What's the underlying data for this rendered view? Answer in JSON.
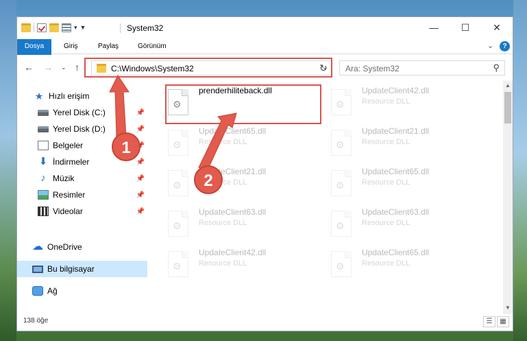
{
  "window": {
    "title": "System32",
    "minimize_icon": "—",
    "maximize_icon": "☐",
    "close_icon": "✕"
  },
  "ribbon": {
    "tabs": [
      "Dosya",
      "Giriş",
      "Paylaş",
      "Görünüm"
    ],
    "file_color": "#1979ca",
    "help_label": "?"
  },
  "address": {
    "path": "C:\\Windows\\System32",
    "search_placeholder": "Ara: System32"
  },
  "sidebar": {
    "items": [
      {
        "label": "Hızlı erişim",
        "icon": "star-icon"
      },
      {
        "label": "Yerel Disk (C:)",
        "icon": "disk-icon",
        "pinned": true
      },
      {
        "label": "Yerel Disk (D:)",
        "icon": "disk-icon",
        "pinned": true
      },
      {
        "label": "Belgeler",
        "icon": "document-icon",
        "pinned": true
      },
      {
        "label": "İndirmeler",
        "icon": "download-icon",
        "pinned": true
      },
      {
        "label": "Müzik",
        "icon": "music-icon",
        "pinned": true
      },
      {
        "label": "Resimler",
        "icon": "pictures-icon",
        "pinned": true
      },
      {
        "label": "Videolar",
        "icon": "videos-icon",
        "pinned": true
      },
      {
        "label": "OneDrive",
        "icon": "onedrive-icon"
      },
      {
        "label": "Bu bilgisayar",
        "icon": "computer-icon",
        "selected": true
      },
      {
        "label": "Ağ",
        "icon": "network-icon"
      }
    ]
  },
  "files": {
    "left_column": [
      {
        "name": "prenderhiliteback.dll",
        "type": ""
      },
      {
        "name": "UpdateClient65.dll",
        "type": "Resource DLL"
      },
      {
        "name": "UpdateClient21.dll",
        "type": "Resource DLL"
      },
      {
        "name": "UpdateClient63.dll",
        "type": "Resource DLL"
      },
      {
        "name": "UpdateClient42.dll",
        "type": "Resource DLL"
      }
    ],
    "right_column": [
      {
        "name": "UpdateClient42.dll",
        "type": "Resource DLL"
      },
      {
        "name": "UpdateClient21.dll",
        "type": "Resource DLL"
      },
      {
        "name": "UpdateClient65.dll",
        "type": "Resource DLL"
      },
      {
        "name": "UpdateClient63.dll",
        "type": "Resource DLL"
      },
      {
        "name": "UpdateClient65.dll",
        "type": "Resource DLL"
      }
    ]
  },
  "status": {
    "count": "138 öğe"
  },
  "annotations": {
    "marker1": "1",
    "marker2": "2",
    "highlight_color": "#d9534f"
  }
}
